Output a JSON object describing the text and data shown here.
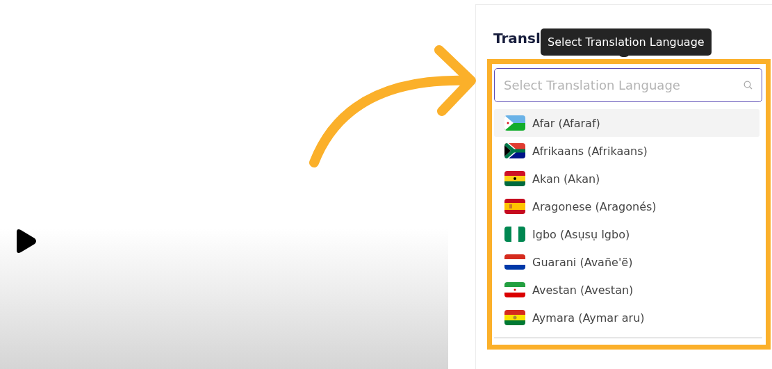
{
  "panel": {
    "heading": "Transl",
    "tooltip": "Select Translation Language"
  },
  "search": {
    "placeholder": "Select Translation Language"
  },
  "languages": [
    {
      "label": "Afar (Afaraf)",
      "kind": "djibouti",
      "selected": true
    },
    {
      "label": "Afrikaans (Afrikaans)",
      "kind": "southafrica",
      "selected": false
    },
    {
      "label": "Akan (Akan)",
      "kind": "ghana",
      "selected": false
    },
    {
      "label": "Aragonese (Aragonés)",
      "kind": "spain",
      "selected": false
    },
    {
      "label": "Igbo (Asụsụ Igbo)",
      "kind": "nigeria",
      "selected": false
    },
    {
      "label": "Guarani (Avañe'ẽ)",
      "kind": "paraguay",
      "selected": false
    },
    {
      "label": "Avestan (Avestan)",
      "kind": "iran",
      "selected": false
    },
    {
      "label": "Aymara (Aymar aru)",
      "kind": "bolivia",
      "selected": false
    }
  ]
}
